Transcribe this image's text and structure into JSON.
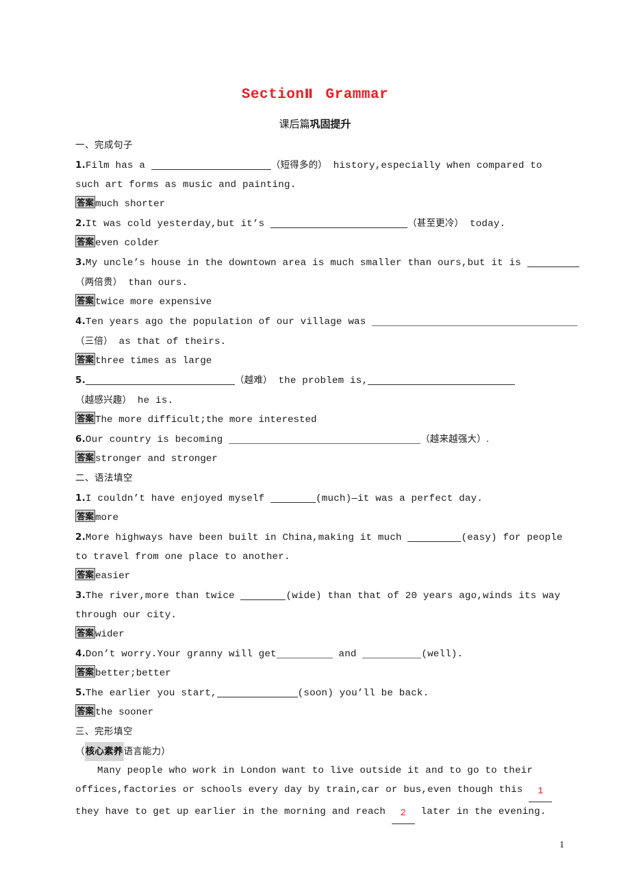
{
  "header": {
    "title_prefix": "Section",
    "title_numeral": "Ⅱ",
    "title_suffix": "Grammar",
    "title_color": "#ed1c24",
    "subtitle_light": "课后篇",
    "subtitle_heavy": "巩固提升"
  },
  "answer_tag_label": "答案",
  "sections": [
    {
      "heading": "一、完成句子",
      "items": [
        {
          "num": "1.",
          "text_a": "Film has a ",
          "hint": "（短得多的）",
          "text_b": " history,especially when compared to",
          "text_c": "such art forms as music and painting.",
          "answer": "much shorter"
        },
        {
          "num": "2.",
          "text_a": "It was cold yesterday,but it’s ",
          "hint": "（甚至更冷）",
          "text_b": " today.",
          "answer": "even colder"
        },
        {
          "num": "3.",
          "text_a": "My uncle’s house in the downtown area is much smaller than ours,but it is ",
          "hint": "（两倍贵）",
          "text_c": " than ours.",
          "answer": "twice more expensive"
        },
        {
          "num": "4.",
          "text_a": "Ten years ago the population of our village was ",
          "hint": "（三倍）",
          "text_c": " as that of theirs.",
          "answer": "three times as large"
        },
        {
          "num": "5.",
          "text_a": "",
          "hint": "（越难）",
          "text_b": " the problem is,",
          "hint2": "（越感兴趣）",
          "text_c": " he is.",
          "answer": "The more difficult;the more interested"
        },
        {
          "num": "6.",
          "text_a": "Our country is becoming ",
          "hint": "（越来越强大）.",
          "answer": "stronger and stronger"
        }
      ]
    },
    {
      "heading": "二、语法填空",
      "items": [
        {
          "num": "1.",
          "text_a": "I couldn’t have enjoyed myself ",
          "cue": "(much)",
          "text_b": "—it was a perfect day.",
          "answer": "more"
        },
        {
          "num": "2.",
          "text_a": "More highways have been built in China,making it much ",
          "cue": "(easy)",
          "text_b": " for people",
          "text_c": "to travel from one place to another.",
          "answer": "easier"
        },
        {
          "num": "3.",
          "text_a": "The river,more than twice ",
          "cue": "(wide)",
          "text_b": " than that of 20 years ago,winds its way",
          "text_c": "through our city.",
          "answer": "wider"
        },
        {
          "num": "4.",
          "text_a": "Don’t worry.Your granny will get",
          "mid": " and ",
          "cue": "(well).",
          "answer": "better;better"
        },
        {
          "num": "5.",
          "text_a": "The earlier you start,",
          "cue": "(soon)",
          "text_b": " you’ll be back.",
          "answer": "the sooner"
        }
      ]
    },
    {
      "heading": "三、完形填空",
      "competency_paren_open": "（",
      "competency_badge": "核心素养",
      "competency_label": "语言能力",
      "competency_paren_close": "）",
      "passage": {
        "line1": "Many people who work in London want to live outside it and to go to their",
        "line2_a": "offices,factories or schools every day by train,car or bus,even though this ",
        "blank1": "1",
        "line3_a": "they have to get up earlier in the morning and reach ",
        "blank2": "2",
        "line3_b": " later in the evening."
      }
    }
  ],
  "footer": {
    "page_number": "1"
  }
}
